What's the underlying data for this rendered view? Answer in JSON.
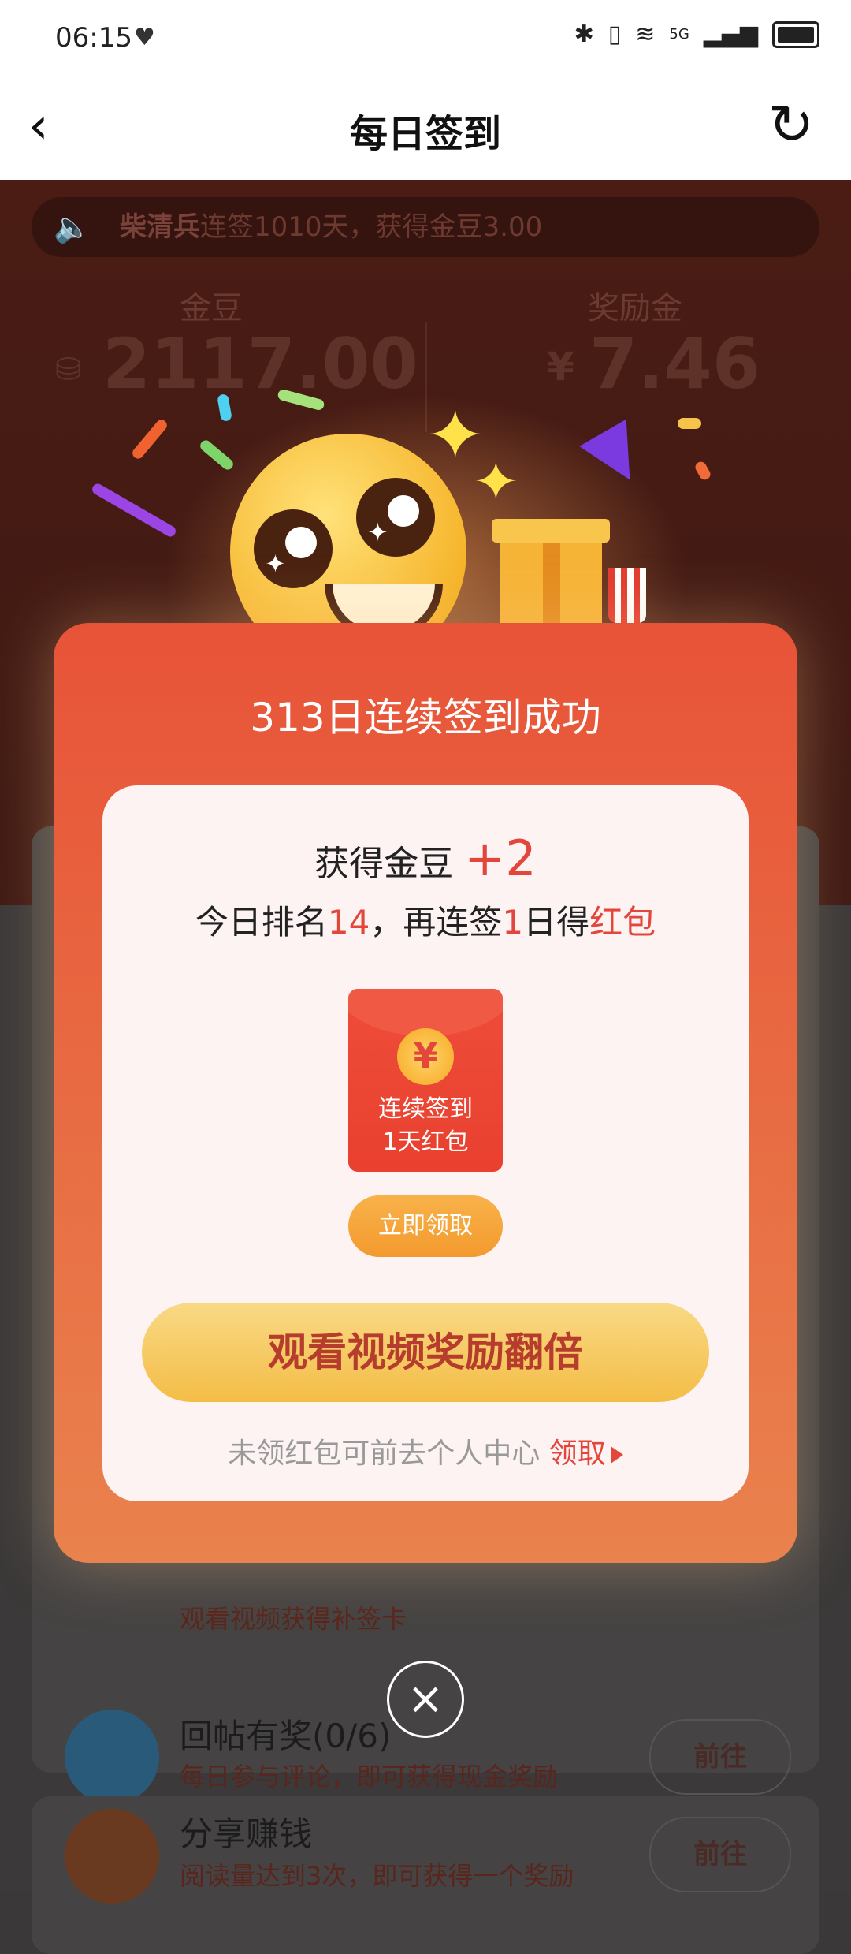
{
  "status_bar": {
    "time": "06:15",
    "network": "5G"
  },
  "nav": {
    "back": "‹",
    "title": "每日签到",
    "refresh": "↻"
  },
  "ticker": {
    "name": "柴清兵",
    "text": "连签1010天，获得金豆3.00"
  },
  "stats": {
    "gold_label": "金豆",
    "gold_value": "2117.00",
    "bonus_label": "奖励金",
    "bonus_currency": "¥",
    "bonus_value": "7.46"
  },
  "tasks": [
    {
      "title": "回帖有奖(0/6)",
      "desc": "每日参与评论，即可获得现金奖励",
      "button": "前往"
    },
    {
      "title": "分享赚钱",
      "desc": "阅读量达到3次，即可获得一个奖励",
      "button": "前往"
    }
  ],
  "partial_task_desc": "观看视频获得补签卡",
  "modal": {
    "title": "313日连续签到成功",
    "reward_prefix": "获得金豆 ",
    "reward_amount": "+2",
    "rank_prefix": "今日排名",
    "rank": "14",
    "rank_mid": "，再连签",
    "days": "1",
    "days_suffix": "日得",
    "red_packet": "红包",
    "envelope_coin": "¥",
    "envelope_line1": "连续签到",
    "envelope_line2": "1天红包",
    "claim_button": "立即领取",
    "watch_button": "观看视频奖励翻倍",
    "footer_text": "未领红包可前去个人中心",
    "footer_link": "领取"
  },
  "close": "×",
  "colors": {
    "accent": "#e3463b",
    "modal_top": "#e85338",
    "button_gold": "#f4bd47"
  }
}
